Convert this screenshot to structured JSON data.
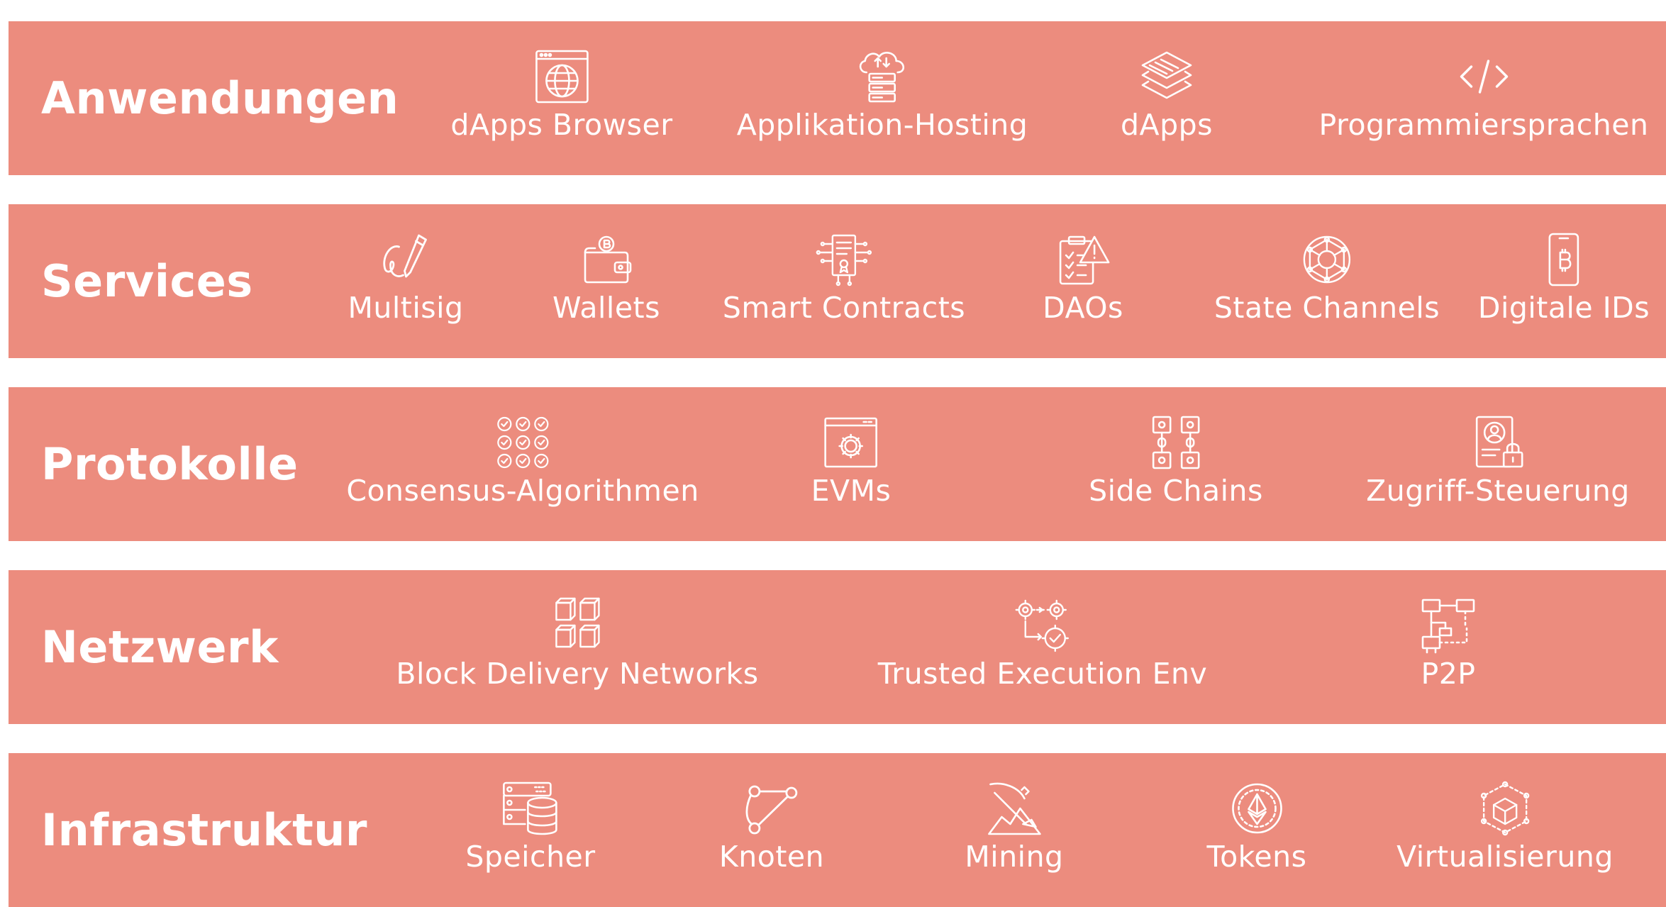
{
  "layers": [
    {
      "id": "anwendungen",
      "title": "Anwendungen",
      "items": [
        {
          "label": "dApps Browser",
          "icon": "browser-globe-icon"
        },
        {
          "label": "Applikation-Hosting",
          "icon": "cloud-server-icon"
        },
        {
          "label": "dApps",
          "icon": "layers-icon"
        },
        {
          "label": "Programmiersprachen",
          "icon": "code-icon"
        }
      ]
    },
    {
      "id": "services",
      "title": "Services",
      "items": [
        {
          "label": "Multisig",
          "icon": "signature-pen-icon"
        },
        {
          "label": "Wallets",
          "icon": "bitcoin-wallet-icon"
        },
        {
          "label": "Smart Contracts",
          "icon": "smart-contract-icon"
        },
        {
          "label": "DAOs",
          "icon": "clipboard-alert-icon"
        },
        {
          "label": "State Channels",
          "icon": "network-sphere-icon"
        },
        {
          "label": "Digitale IDs",
          "icon": "bitcoin-phone-icon"
        }
      ]
    },
    {
      "id": "protokolle",
      "title": "Protokolle",
      "items": [
        {
          "label": "Consensus-Algorithmen",
          "icon": "check-grid-icon"
        },
        {
          "label": "EVMs",
          "icon": "gear-window-icon"
        },
        {
          "label": "Side Chains",
          "icon": "side-chains-icon"
        },
        {
          "label": "Zugriff-Steuerung",
          "icon": "id-lock-icon"
        }
      ]
    },
    {
      "id": "netzwerk",
      "title": "Netzwerk",
      "items": [
        {
          "label": "Block Delivery Networks",
          "icon": "cubes-icon"
        },
        {
          "label": "Trusted Execution Env",
          "icon": "gears-check-icon"
        },
        {
          "label": "P2P",
          "icon": "p2p-network-icon"
        }
      ]
    },
    {
      "id": "infrastruktur",
      "title": "Infrastruktur",
      "items": [
        {
          "label": "Speicher",
          "icon": "database-icon"
        },
        {
          "label": "Knoten",
          "icon": "nodes-icon"
        },
        {
          "label": "Mining",
          "icon": "pickaxe-icon"
        },
        {
          "label": "Tokens",
          "icon": "ethereum-coin-icon"
        },
        {
          "label": "Virtualisierung",
          "icon": "virtual-cube-icon"
        }
      ]
    }
  ],
  "colors": {
    "band": "#ec8c7e",
    "text": "#ffffff",
    "background": "#ffffff"
  }
}
